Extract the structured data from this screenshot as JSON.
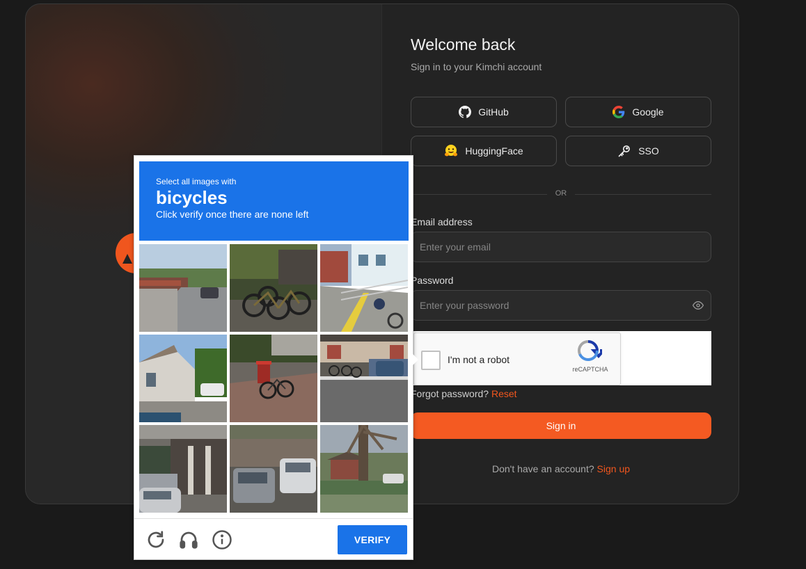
{
  "auth": {
    "title": "Welcome back",
    "subtitle": "Sign in to your Kimchi account",
    "providers": [
      {
        "label": "GitHub",
        "icon": "github-icon"
      },
      {
        "label": "Google",
        "icon": "google-icon"
      },
      {
        "label": "HuggingFace",
        "icon": "huggingface-icon"
      },
      {
        "label": "SSO",
        "icon": "key-icon"
      }
    ],
    "divider": "OR",
    "email": {
      "label": "Email address",
      "placeholder": "Enter your email",
      "value": ""
    },
    "password": {
      "label": "Password",
      "placeholder": "Enter your password",
      "value": "",
      "toggle_icon": "eye-icon"
    },
    "recaptcha": {
      "label": "I'm not a robot",
      "brand": "reCAPTCHA",
      "checked": false
    },
    "forgot": {
      "text": "Forgot password?",
      "link": "Reset"
    },
    "submit": "Sign in",
    "signup": {
      "text": "Don't have an account?",
      "link": "Sign up"
    },
    "accent_color": "#f45a22"
  },
  "captcha": {
    "instruction": "Select all images with",
    "target": "bicycles",
    "hint": "Click verify once there are none left",
    "tiles": [
      {
        "description": "street with market tents"
      },
      {
        "description": "parked bicycles"
      },
      {
        "description": "building with railing and cyclist"
      },
      {
        "description": "house with car"
      },
      {
        "description": "bicycle near bin"
      },
      {
        "description": "cars and bicycles on street"
      },
      {
        "description": "building entrance with car"
      },
      {
        "description": "cars on street"
      },
      {
        "description": "tree and houses"
      }
    ],
    "footer_icons": [
      "reload-icon",
      "headphones-icon",
      "info-icon"
    ],
    "verify_label": "VERIFY",
    "header_color": "#1a73e8"
  }
}
